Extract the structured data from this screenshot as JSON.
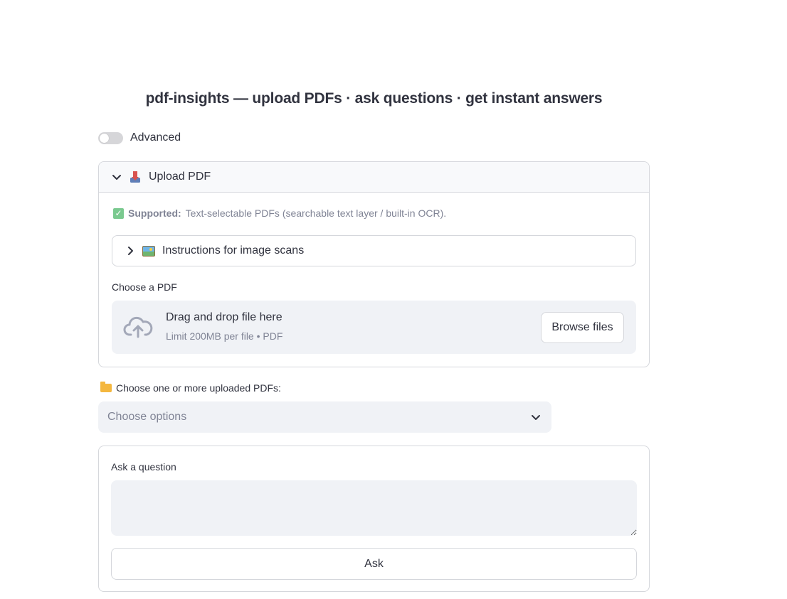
{
  "page": {
    "title": "pdf-insights — upload PDFs · ask questions · get instant answers"
  },
  "advanced_toggle": {
    "label": "Advanced",
    "checked": false
  },
  "upload_expander": {
    "icon": "inbox-tray-icon",
    "label": "Upload PDF",
    "expanded": true,
    "supported_icon": "check-mark-icon",
    "supported_bold": "Supported:",
    "supported_text": "Text-selectable PDFs (searchable text layer / built-in OCR).",
    "instructions": {
      "icon": "framed-picture-icon",
      "label": "Instructions for image scans",
      "expanded": false
    },
    "file_uploader": {
      "label": "Choose a PDF",
      "icon": "cloud-upload-icon",
      "drag_text": "Drag and drop file here",
      "limit_text": "Limit 200MB per file • PDF",
      "browse_label": "Browse files"
    }
  },
  "multiselect": {
    "icon": "folder-icon",
    "label": "Choose one or more uploaded PDFs:",
    "placeholder": "Choose options"
  },
  "question_form": {
    "label": "Ask a question",
    "value": "",
    "submit_label": "Ask"
  },
  "colors": {
    "text": "#31333f",
    "muted": "#808495",
    "input_bg": "#f0f2f6",
    "border": "#d5d7dc"
  }
}
